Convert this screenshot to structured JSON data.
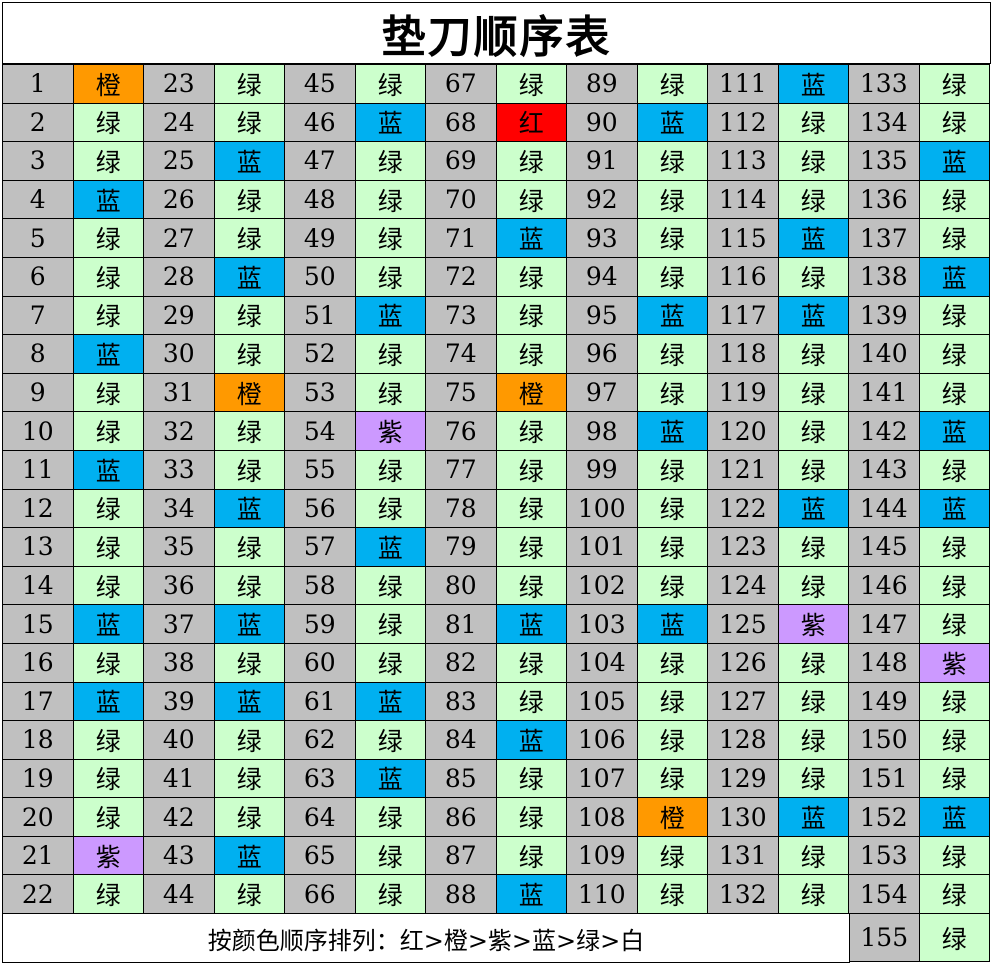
{
  "title": "垫刀顺序表",
  "footer_text": "按颜色顺序排列：红>橙>紫>蓝>绿>白",
  "legend_colors": {
    "红": "#ff0000",
    "橙": "#ff9900",
    "紫": "#cc99ff",
    "蓝": "#00b0f0",
    "绿": "#ccffcc",
    "白": "#ffffff"
  },
  "rows_per_column": 22,
  "entries": [
    {
      "n": "1",
      "c": "橙"
    },
    {
      "n": "2",
      "c": "绿"
    },
    {
      "n": "3",
      "c": "绿"
    },
    {
      "n": "4",
      "c": "蓝"
    },
    {
      "n": "5",
      "c": "绿"
    },
    {
      "n": "6",
      "c": "绿"
    },
    {
      "n": "7",
      "c": "绿"
    },
    {
      "n": "8",
      "c": "蓝"
    },
    {
      "n": "9",
      "c": "绿"
    },
    {
      "n": "10",
      "c": "绿"
    },
    {
      "n": "11",
      "c": "蓝"
    },
    {
      "n": "12",
      "c": "绿"
    },
    {
      "n": "13",
      "c": "绿"
    },
    {
      "n": "14",
      "c": "绿"
    },
    {
      "n": "15",
      "c": "蓝"
    },
    {
      "n": "16",
      "c": "绿"
    },
    {
      "n": "17",
      "c": "蓝"
    },
    {
      "n": "18",
      "c": "绿"
    },
    {
      "n": "19",
      "c": "绿"
    },
    {
      "n": "20",
      "c": "绿"
    },
    {
      "n": "21",
      "c": "紫"
    },
    {
      "n": "22",
      "c": "绿"
    },
    {
      "n": "23",
      "c": "绿"
    },
    {
      "n": "24",
      "c": "绿"
    },
    {
      "n": "25",
      "c": "蓝"
    },
    {
      "n": "26",
      "c": "绿"
    },
    {
      "n": "27",
      "c": "绿"
    },
    {
      "n": "28",
      "c": "蓝"
    },
    {
      "n": "29",
      "c": "绿"
    },
    {
      "n": "30",
      "c": "绿"
    },
    {
      "n": "31",
      "c": "橙"
    },
    {
      "n": "32",
      "c": "绿"
    },
    {
      "n": "33",
      "c": "绿"
    },
    {
      "n": "34",
      "c": "蓝"
    },
    {
      "n": "35",
      "c": "绿"
    },
    {
      "n": "36",
      "c": "绿"
    },
    {
      "n": "37",
      "c": "蓝"
    },
    {
      "n": "38",
      "c": "绿"
    },
    {
      "n": "39",
      "c": "蓝"
    },
    {
      "n": "40",
      "c": "绿"
    },
    {
      "n": "41",
      "c": "绿"
    },
    {
      "n": "42",
      "c": "绿"
    },
    {
      "n": "43",
      "c": "蓝"
    },
    {
      "n": "44",
      "c": "绿"
    },
    {
      "n": "45",
      "c": "绿"
    },
    {
      "n": "46",
      "c": "蓝"
    },
    {
      "n": "47",
      "c": "绿"
    },
    {
      "n": "48",
      "c": "绿"
    },
    {
      "n": "49",
      "c": "绿"
    },
    {
      "n": "50",
      "c": "绿"
    },
    {
      "n": "51",
      "c": "蓝"
    },
    {
      "n": "52",
      "c": "绿"
    },
    {
      "n": "53",
      "c": "绿"
    },
    {
      "n": "54",
      "c": "紫"
    },
    {
      "n": "55",
      "c": "绿"
    },
    {
      "n": "56",
      "c": "绿"
    },
    {
      "n": "57",
      "c": "蓝"
    },
    {
      "n": "58",
      "c": "绿"
    },
    {
      "n": "59",
      "c": "绿"
    },
    {
      "n": "60",
      "c": "绿"
    },
    {
      "n": "61",
      "c": "蓝"
    },
    {
      "n": "62",
      "c": "绿"
    },
    {
      "n": "63",
      "c": "蓝"
    },
    {
      "n": "64",
      "c": "绿"
    },
    {
      "n": "65",
      "c": "绿"
    },
    {
      "n": "66",
      "c": "绿"
    },
    {
      "n": "67",
      "c": "绿"
    },
    {
      "n": "68",
      "c": "红"
    },
    {
      "n": "69",
      "c": "绿"
    },
    {
      "n": "70",
      "c": "绿"
    },
    {
      "n": "71",
      "c": "蓝"
    },
    {
      "n": "72",
      "c": "绿"
    },
    {
      "n": "73",
      "c": "绿"
    },
    {
      "n": "74",
      "c": "绿"
    },
    {
      "n": "75",
      "c": "橙"
    },
    {
      "n": "76",
      "c": "绿"
    },
    {
      "n": "77",
      "c": "绿"
    },
    {
      "n": "78",
      "c": "绿"
    },
    {
      "n": "79",
      "c": "绿"
    },
    {
      "n": "80",
      "c": "绿"
    },
    {
      "n": "81",
      "c": "蓝"
    },
    {
      "n": "82",
      "c": "绿"
    },
    {
      "n": "83",
      "c": "绿"
    },
    {
      "n": "84",
      "c": "蓝"
    },
    {
      "n": "85",
      "c": "绿"
    },
    {
      "n": "86",
      "c": "绿"
    },
    {
      "n": "87",
      "c": "绿"
    },
    {
      "n": "88",
      "c": "蓝"
    },
    {
      "n": "89",
      "c": "绿"
    },
    {
      "n": "90",
      "c": "蓝"
    },
    {
      "n": "91",
      "c": "绿"
    },
    {
      "n": "92",
      "c": "绿"
    },
    {
      "n": "93",
      "c": "绿"
    },
    {
      "n": "94",
      "c": "绿"
    },
    {
      "n": "95",
      "c": "蓝"
    },
    {
      "n": "96",
      "c": "绿"
    },
    {
      "n": "97",
      "c": "绿"
    },
    {
      "n": "98",
      "c": "蓝"
    },
    {
      "n": "99",
      "c": "绿"
    },
    {
      "n": "100",
      "c": "绿"
    },
    {
      "n": "101",
      "c": "绿"
    },
    {
      "n": "102",
      "c": "绿"
    },
    {
      "n": "103",
      "c": "蓝"
    },
    {
      "n": "104",
      "c": "绿"
    },
    {
      "n": "105",
      "c": "绿"
    },
    {
      "n": "106",
      "c": "绿"
    },
    {
      "n": "107",
      "c": "绿"
    },
    {
      "n": "108",
      "c": "橙"
    },
    {
      "n": "109",
      "c": "绿"
    },
    {
      "n": "110",
      "c": "绿"
    },
    {
      "n": "111",
      "c": "蓝"
    },
    {
      "n": "112",
      "c": "绿"
    },
    {
      "n": "113",
      "c": "绿"
    },
    {
      "n": "114",
      "c": "绿"
    },
    {
      "n": "115",
      "c": "蓝"
    },
    {
      "n": "116",
      "c": "绿"
    },
    {
      "n": "117",
      "c": "蓝"
    },
    {
      "n": "118",
      "c": "绿"
    },
    {
      "n": "119",
      "c": "绿"
    },
    {
      "n": "120",
      "c": "绿"
    },
    {
      "n": "121",
      "c": "绿"
    },
    {
      "n": "122",
      "c": "蓝"
    },
    {
      "n": "123",
      "c": "绿"
    },
    {
      "n": "124",
      "c": "绿"
    },
    {
      "n": "125",
      "c": "紫"
    },
    {
      "n": "126",
      "c": "绿"
    },
    {
      "n": "127",
      "c": "绿"
    },
    {
      "n": "128",
      "c": "绿"
    },
    {
      "n": "129",
      "c": "绿"
    },
    {
      "n": "130",
      "c": "蓝"
    },
    {
      "n": "131",
      "c": "绿"
    },
    {
      "n": "132",
      "c": "绿"
    },
    {
      "n": "133",
      "c": "绿"
    },
    {
      "n": "134",
      "c": "绿"
    },
    {
      "n": "135",
      "c": "蓝"
    },
    {
      "n": "136",
      "c": "绿"
    },
    {
      "n": "137",
      "c": "绿"
    },
    {
      "n": "138",
      "c": "蓝"
    },
    {
      "n": "139",
      "c": "绿"
    },
    {
      "n": "140",
      "c": "绿"
    },
    {
      "n": "141",
      "c": "绿"
    },
    {
      "n": "142",
      "c": "蓝"
    },
    {
      "n": "143",
      "c": "绿"
    },
    {
      "n": "144",
      "c": "蓝"
    },
    {
      "n": "145",
      "c": "绿"
    },
    {
      "n": "146",
      "c": "绿"
    },
    {
      "n": "147",
      "c": "绿"
    },
    {
      "n": "148",
      "c": "紫"
    },
    {
      "n": "149",
      "c": "绿"
    },
    {
      "n": "150",
      "c": "绿"
    },
    {
      "n": "151",
      "c": "绿"
    },
    {
      "n": "152",
      "c": "蓝"
    },
    {
      "n": "153",
      "c": "绿"
    },
    {
      "n": "154",
      "c": "绿"
    },
    {
      "n": "155",
      "c": "绿"
    }
  ]
}
